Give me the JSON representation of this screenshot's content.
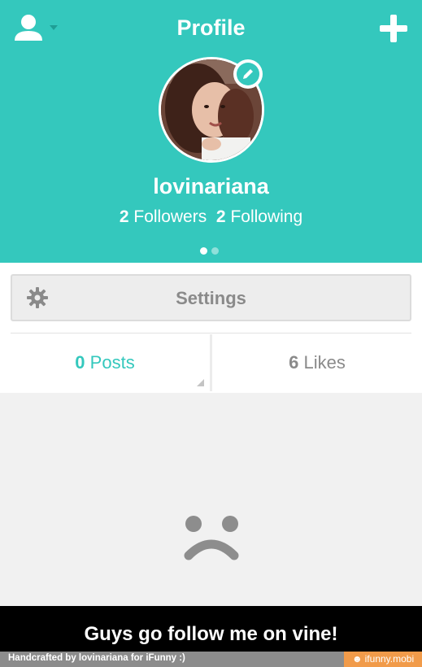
{
  "header": {
    "title": "Profile",
    "username": "lovinariana",
    "followers_count": "2",
    "followers_label": "Followers",
    "following_count": "2",
    "following_label": "Following",
    "accent_color": "#34c8bd",
    "page_indicator": {
      "total": 2,
      "active": 1
    }
  },
  "icons": {
    "user_menu": "user-icon",
    "add": "plus-icon",
    "edit": "pencil-icon",
    "settings": "gear-icon",
    "empty_state": "sad-face-icon"
  },
  "settings": {
    "label": "Settings"
  },
  "tabs": [
    {
      "count": "0",
      "label": "Posts",
      "active": true
    },
    {
      "count": "6",
      "label": "Likes",
      "active": false
    }
  ],
  "caption": "Guys go follow me on vine!",
  "footer": {
    "credit": "Handcrafted by lovinariana for iFunny :)",
    "brand": "ifunny.mobi",
    "brand_color": "#f19b4a"
  }
}
